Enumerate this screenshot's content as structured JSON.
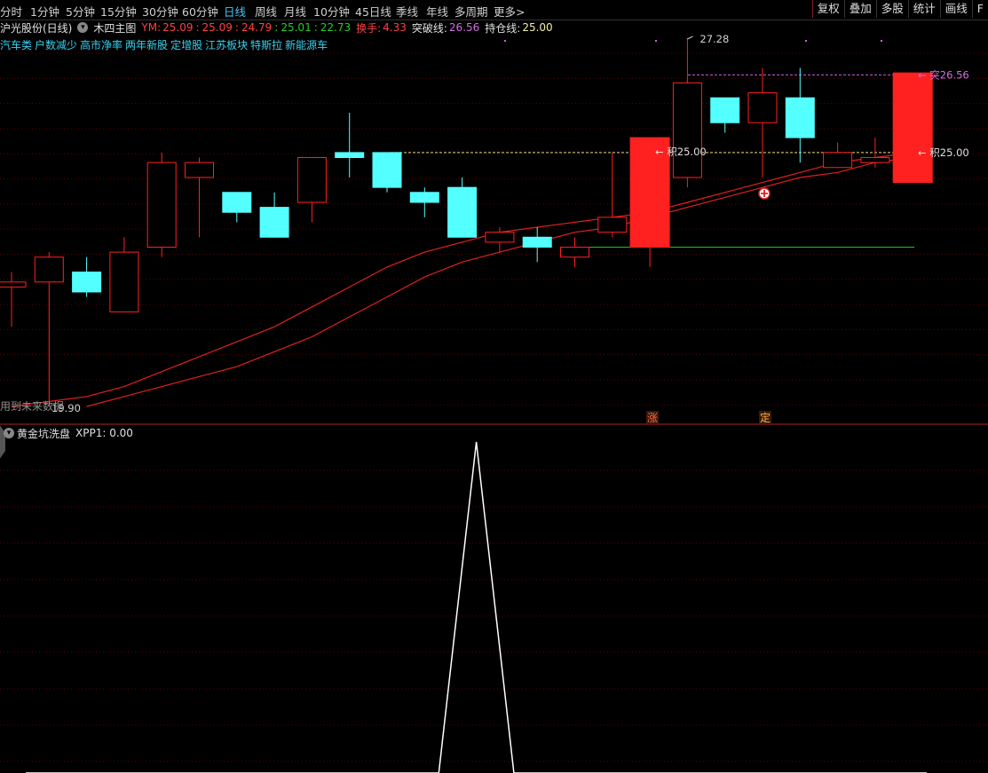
{
  "toolbar": {
    "periods": [
      "分时",
      "1分钟",
      "5分钟",
      "15分钟",
      "30分钟",
      "60分钟",
      "日线",
      "周线",
      "月线",
      "10分钟",
      "45日线",
      "季线",
      "年线",
      "多周期",
      "更多>"
    ],
    "active_period": "日线",
    "right_buttons": [
      "复权",
      "叠加",
      "多股",
      "统计",
      "画线",
      "F"
    ]
  },
  "stock": {
    "name": "沪光股份(日线)",
    "indicator": "木四主图",
    "ym_label": "YM:",
    "ym_values": [
      "25.09",
      "25.09",
      "24.79",
      "25.01",
      "22.73"
    ],
    "turnover_label": "换手:",
    "turnover_value": "4.33",
    "breakout_label": "突破线:",
    "breakout_value": "26.56",
    "hold_label": "持仓线:",
    "hold_value": "25.00"
  },
  "concepts": [
    "汽车类",
    "户数减少",
    "高市净率",
    "两年新股",
    "定增股",
    "江苏板块",
    "特斯拉",
    "新能源车"
  ],
  "annotations": {
    "high_price": "27.28",
    "low_price": "19.90",
    "breakout_tag": "← 突26.56",
    "hold_tag_right": "← 积25.00",
    "hold_tag_mid": "← 积25.00",
    "future_data_note": "用到未来数据",
    "marker_zhang": "涨",
    "marker_ding": "定"
  },
  "sub_chart": {
    "name": "黄金坑洗盘",
    "value_label": "XPP1: 0.00"
  },
  "colors": {
    "up": "#ff2020",
    "down": "#54ffff",
    "ma": "#e02020",
    "breakout_line": "#c060e0",
    "hold_line": "#e0e080",
    "support_line": "#20c020",
    "divider": "#8a1c1c"
  },
  "chart_data": {
    "type": "candlestick",
    "ylim": [
      19.9,
      27.28
    ],
    "candles": [
      {
        "open": 22.3,
        "close": 22.4,
        "high": 22.6,
        "low": 21.5
      },
      {
        "open": 22.4,
        "close": 22.9,
        "high": 23.0,
        "low": 19.9
      },
      {
        "open": 22.6,
        "close": 22.2,
        "high": 22.9,
        "low": 22.1
      },
      {
        "open": 21.8,
        "close": 23.0,
        "high": 23.3,
        "low": 21.8
      },
      {
        "open": 23.1,
        "close": 24.8,
        "high": 25.0,
        "low": 22.9
      },
      {
        "open": 24.5,
        "close": 24.8,
        "high": 24.9,
        "low": 23.3
      },
      {
        "open": 24.2,
        "close": 23.8,
        "high": 24.2,
        "low": 23.6
      },
      {
        "open": 23.9,
        "close": 23.3,
        "high": 24.2,
        "low": 23.3
      },
      {
        "open": 24.0,
        "close": 24.9,
        "high": 24.9,
        "low": 23.6
      },
      {
        "open": 25.0,
        "close": 24.9,
        "high": 25.8,
        "low": 24.5
      },
      {
        "open": 25.0,
        "close": 24.3,
        "high": 25.0,
        "low": 24.2
      },
      {
        "open": 24.2,
        "close": 24.0,
        "high": 24.3,
        "low": 23.7
      },
      {
        "open": 24.3,
        "close": 23.3,
        "high": 24.5,
        "low": 23.3
      },
      {
        "open": 23.2,
        "close": 23.4,
        "high": 23.5,
        "low": 23.0
      },
      {
        "open": 23.3,
        "close": 23.1,
        "high": 23.5,
        "low": 22.8
      },
      {
        "open": 22.9,
        "close": 23.1,
        "high": 23.3,
        "low": 22.7
      },
      {
        "open": 23.4,
        "close": 23.7,
        "high": 25.0,
        "low": 23.3
      },
      {
        "open": 23.1,
        "close": 25.3,
        "high": 25.3,
        "low": 22.7
      },
      {
        "open": 24.5,
        "close": 26.4,
        "high": 27.3,
        "low": 24.3
      },
      {
        "open": 26.1,
        "close": 25.6,
        "high": 26.1,
        "low": 25.4
      },
      {
        "open": 25.6,
        "close": 26.2,
        "high": 26.7,
        "low": 24.5
      },
      {
        "open": 26.1,
        "close": 25.3,
        "high": 26.7,
        "low": 24.8
      },
      {
        "open": 24.7,
        "close": 25.0,
        "high": 25.2,
        "low": 24.7
      },
      {
        "open": 24.8,
        "close": 24.9,
        "high": 25.3,
        "low": 24.7
      },
      {
        "open": 24.4,
        "close": 26.6,
        "high": 26.6,
        "low": 24.4
      }
    ],
    "ma_fast": [
      19.9,
      20.0,
      20.1,
      20.3,
      20.6,
      20.9,
      21.2,
      21.5,
      21.9,
      22.3,
      22.7,
      23.0,
      23.2,
      23.4,
      23.5,
      23.6,
      23.7,
      23.8,
      24.0,
      24.2,
      24.4,
      24.6,
      24.8,
      24.9,
      25.0
    ],
    "ma_slow": [
      null,
      null,
      19.9,
      20.1,
      20.3,
      20.5,
      20.7,
      21.0,
      21.3,
      21.7,
      22.1,
      22.5,
      22.8,
      23.0,
      23.2,
      23.4,
      23.5,
      23.7,
      23.9,
      24.1,
      24.3,
      24.5,
      24.6,
      24.8,
      24.9
    ],
    "breakout_line": 26.56,
    "hold_line": 25.0,
    "support_line": 23.1,
    "sub_series": {
      "name": "XPP1",
      "values": [
        0,
        0,
        0,
        0,
        0,
        0,
        0,
        0,
        0,
        0,
        0,
        0,
        1,
        0,
        0,
        0,
        0,
        0,
        0,
        0,
        0,
        0,
        0,
        0,
        0
      ]
    }
  }
}
